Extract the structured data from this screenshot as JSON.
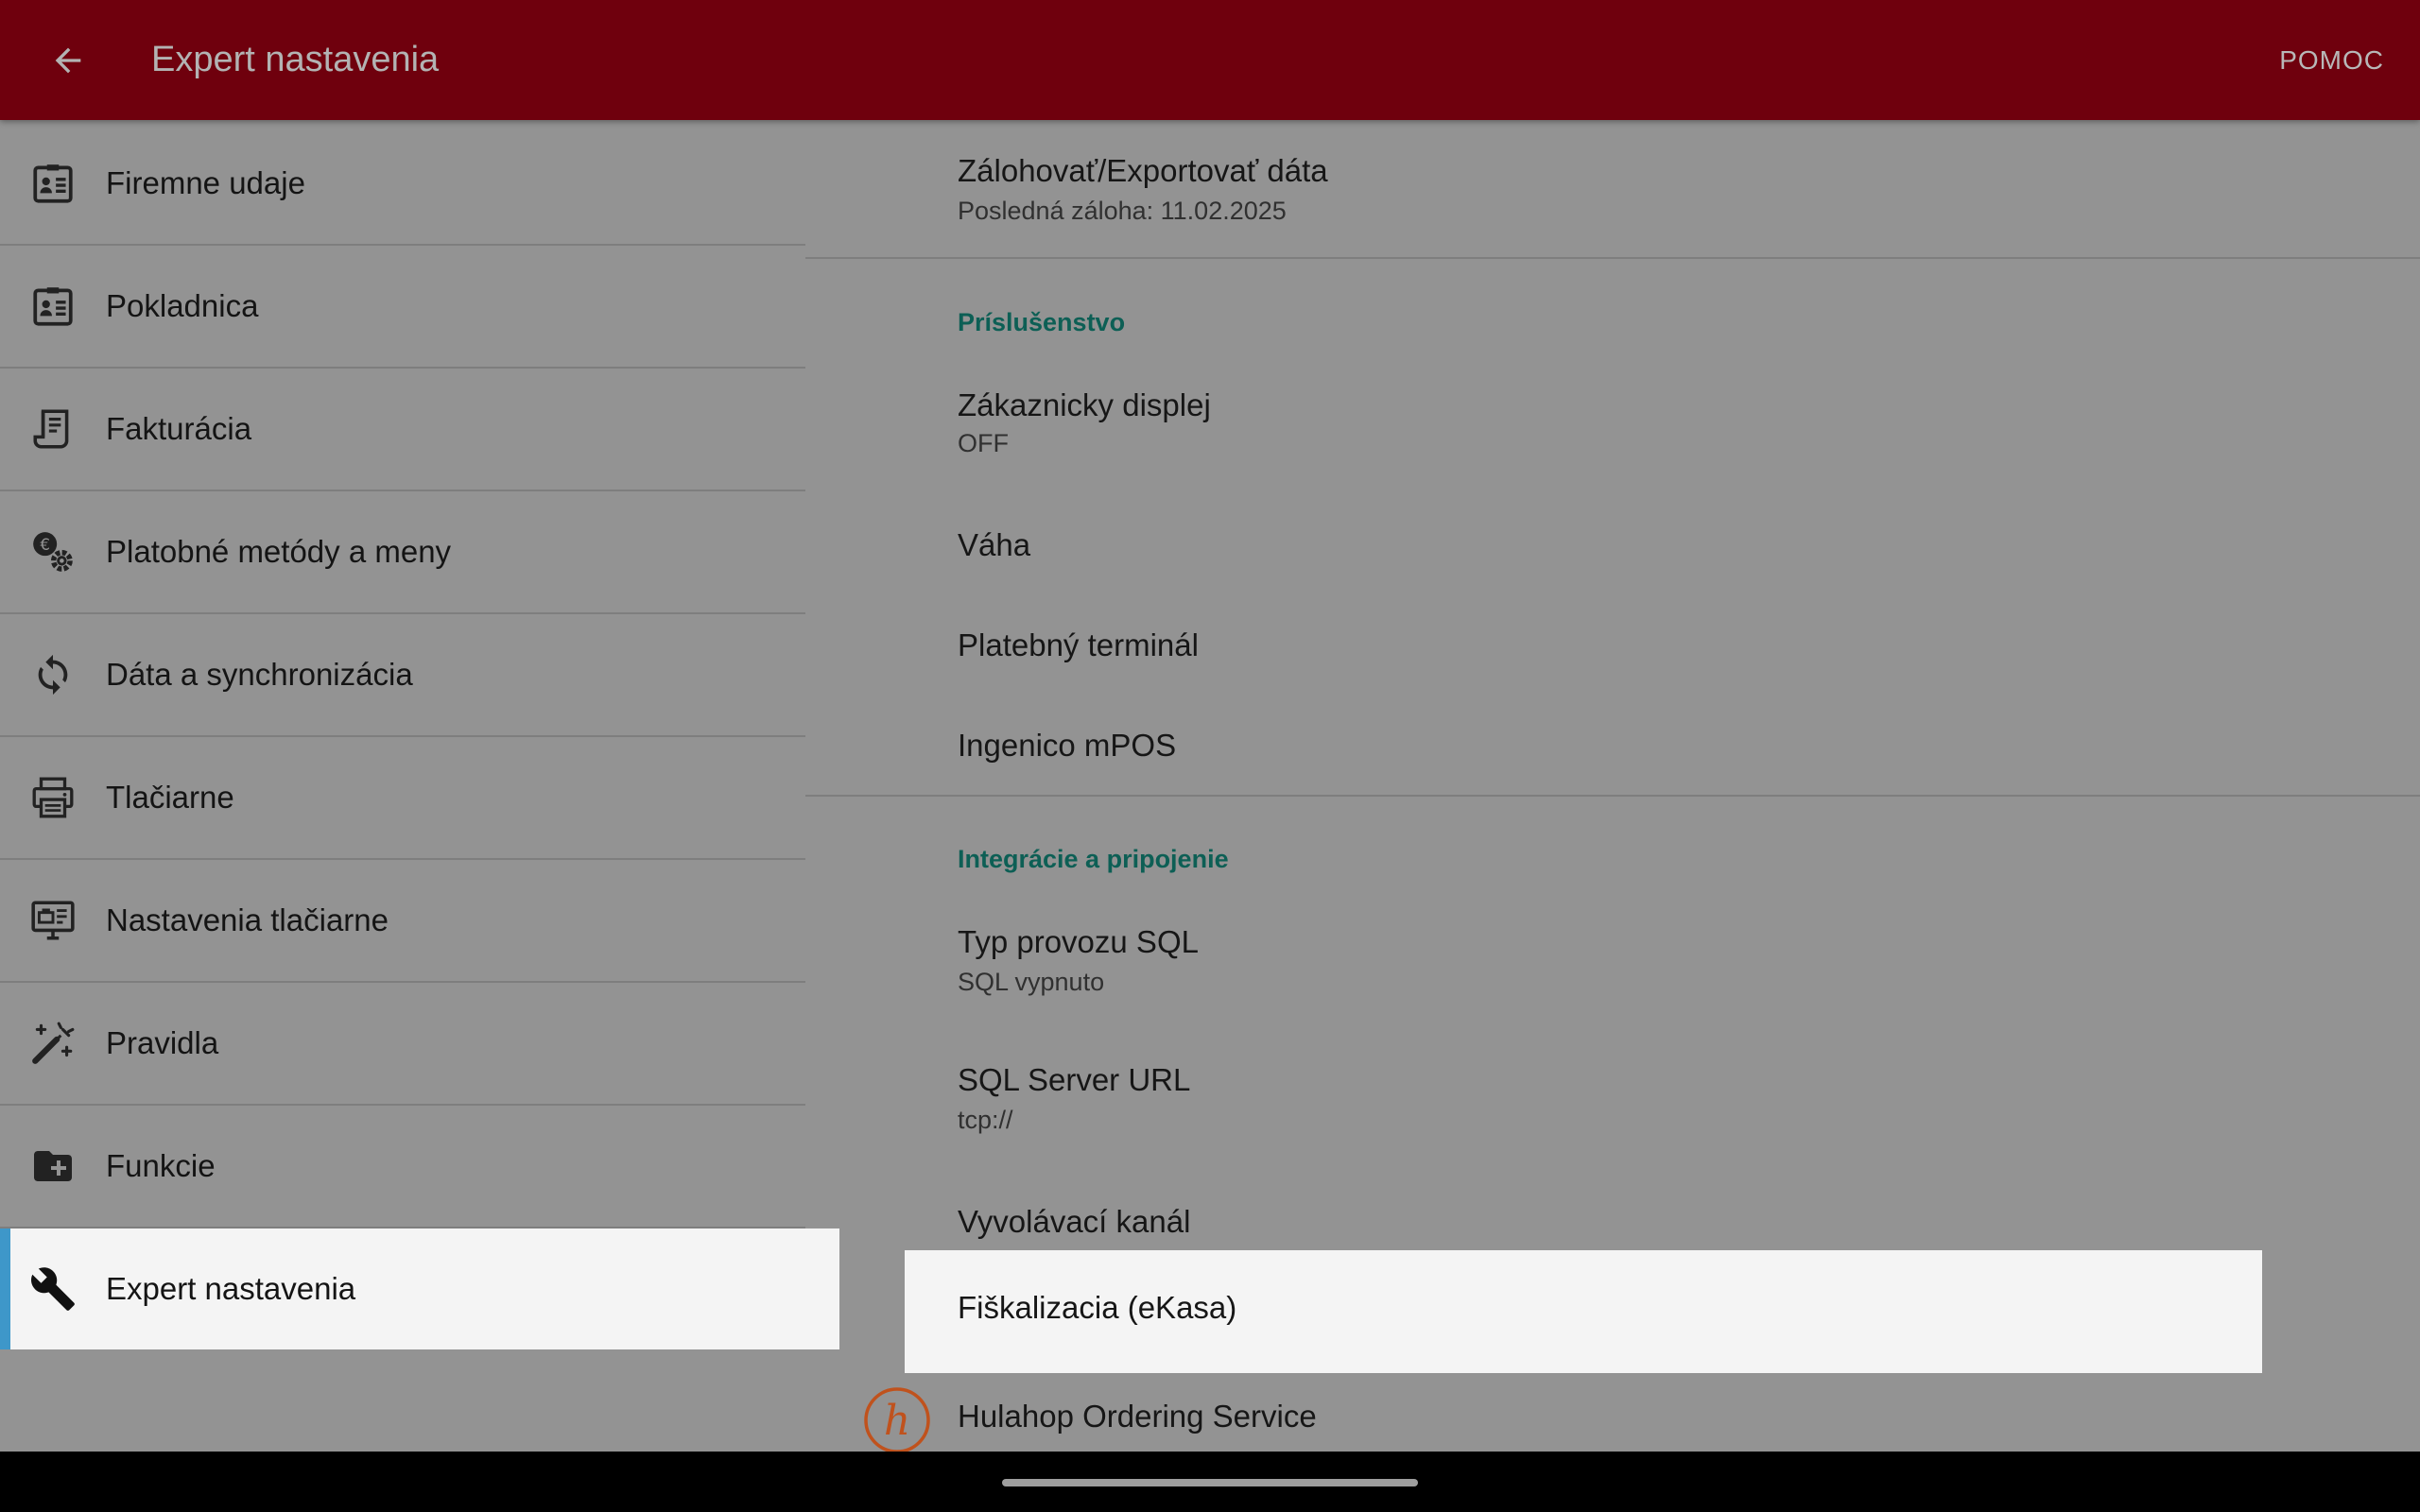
{
  "appbar": {
    "title": "Expert nastavenia",
    "help_label": "POMOC",
    "color": "#6f000d"
  },
  "sidebar": {
    "accent": "#3e97c9",
    "items": [
      {
        "label": "Firemne udaje",
        "icon": "company-card-icon"
      },
      {
        "label": "Pokladnica",
        "icon": "company-card-icon"
      },
      {
        "label": "Fakturácia",
        "icon": "invoice-scroll-icon"
      },
      {
        "label": "Platobné metódy a meny",
        "icon": "euro-gear-icon"
      },
      {
        "label": "Dáta a synchronizácia",
        "icon": "sync-icon"
      },
      {
        "label": "Tlačiarne",
        "icon": "printer-icon"
      },
      {
        "label": "Nastavenia tlačiarne",
        "icon": "printer-settings-icon"
      },
      {
        "label": "Pravidla",
        "icon": "magic-wand-icon"
      },
      {
        "label": "Funkcie",
        "icon": "folder-plus-icon"
      },
      {
        "label": "Expert nastavenia",
        "icon": "wrench-icon",
        "selected": true
      }
    ]
  },
  "main": {
    "backup": {
      "title": "Zálohovať/Exportovať dáta",
      "summary": "Posledná záloha: 11.02.2025"
    },
    "category_accessories": "Príslušenstvo",
    "customer_display": {
      "title": "Zákaznicky displej",
      "summary": "OFF"
    },
    "scale": {
      "title": "Váha"
    },
    "payment_terminal": {
      "title": "Platebný terminál"
    },
    "ingenico": {
      "title": "Ingenico mPOS"
    },
    "category_integrations": "Integrácie a pripojenie",
    "sql_mode": {
      "title": "Typ provozu SQL",
      "summary": "SQL vypnuto"
    },
    "sql_url": {
      "title": "SQL Server URL",
      "summary": "tcp://"
    },
    "call_channel": {
      "title": "Vyvolávací kanál"
    },
    "fiscalization": {
      "title": "Fiškalizacia (eKasa)"
    },
    "hulahop": {
      "title": "Hulahop Ordering Service",
      "logo_letter": "h",
      "logo_color": "#c0521d"
    }
  }
}
